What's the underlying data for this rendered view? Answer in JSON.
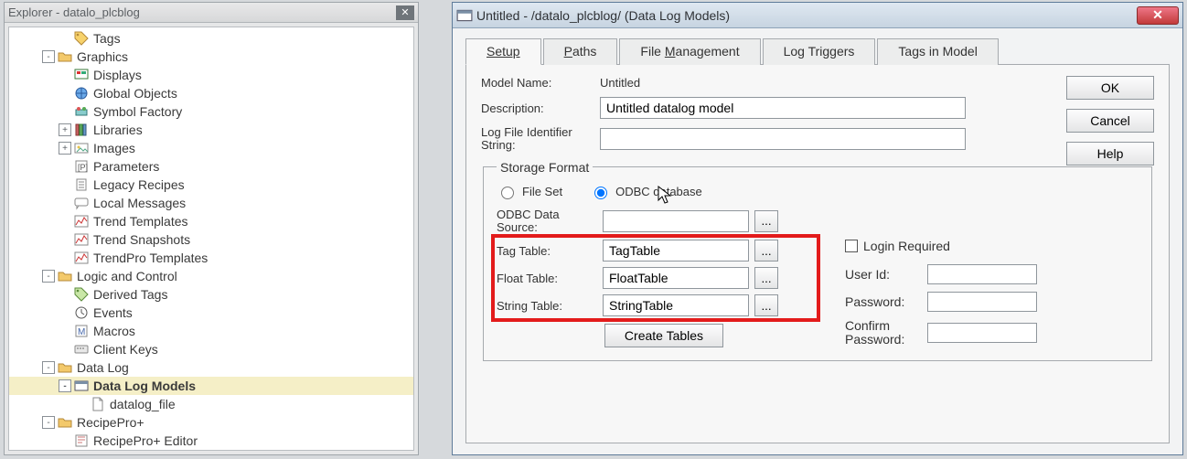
{
  "explorer": {
    "title": "Explorer - datalo_plcblog",
    "tree": [
      {
        "depth": 3,
        "twist": "",
        "icon": "tag",
        "label": "Tags"
      },
      {
        "depth": 2,
        "twist": "-",
        "icon": "folder",
        "label": "Graphics"
      },
      {
        "depth": 3,
        "twist": "",
        "icon": "displays",
        "label": "Displays"
      },
      {
        "depth": 3,
        "twist": "",
        "icon": "globals",
        "label": "Global Objects"
      },
      {
        "depth": 3,
        "twist": "",
        "icon": "symbol",
        "label": "Symbol Factory"
      },
      {
        "depth": 3,
        "twist": "+",
        "icon": "lib",
        "label": "Libraries"
      },
      {
        "depth": 3,
        "twist": "+",
        "icon": "images",
        "label": "Images"
      },
      {
        "depth": 3,
        "twist": "",
        "icon": "params",
        "label": "Parameters"
      },
      {
        "depth": 3,
        "twist": "",
        "icon": "recipe",
        "label": "Legacy Recipes"
      },
      {
        "depth": 3,
        "twist": "",
        "icon": "msg",
        "label": "Local Messages"
      },
      {
        "depth": 3,
        "twist": "",
        "icon": "trend",
        "label": "Trend Templates"
      },
      {
        "depth": 3,
        "twist": "",
        "icon": "trend",
        "label": "Trend Snapshots"
      },
      {
        "depth": 3,
        "twist": "",
        "icon": "trend",
        "label": "TrendPro Templates"
      },
      {
        "depth": 2,
        "twist": "-",
        "icon": "folder",
        "label": "Logic and Control"
      },
      {
        "depth": 3,
        "twist": "",
        "icon": "dtags",
        "label": "Derived Tags"
      },
      {
        "depth": 3,
        "twist": "",
        "icon": "events",
        "label": "Events"
      },
      {
        "depth": 3,
        "twist": "",
        "icon": "macros",
        "label": "Macros"
      },
      {
        "depth": 3,
        "twist": "",
        "icon": "keys",
        "label": "Client Keys"
      },
      {
        "depth": 2,
        "twist": "-",
        "icon": "folder",
        "label": "Data Log"
      },
      {
        "depth": 3,
        "twist": "-",
        "icon": "models",
        "label": "Data Log Models",
        "selected": true
      },
      {
        "depth": 4,
        "twist": "",
        "icon": "file",
        "label": "datalog_file"
      },
      {
        "depth": 2,
        "twist": "-",
        "icon": "folder",
        "label": "RecipePro+"
      },
      {
        "depth": 3,
        "twist": "",
        "icon": "recipepro",
        "label": "RecipePro+ Editor"
      }
    ]
  },
  "dialog": {
    "title": "Untitled - /datalo_plcblog/ (Data Log Models)",
    "tabs": {
      "setup": "Setup",
      "paths": "Paths",
      "file_mgmt": "File Management",
      "log_triggers": "Log Triggers",
      "tags_in_model": "Tags in Model"
    },
    "buttons": {
      "ok": "OK",
      "cancel": "Cancel",
      "help": "Help",
      "create_tables": "Create Tables",
      "browse": "..."
    },
    "labels": {
      "model_name": "Model Name:",
      "description": "Description:",
      "log_file_id": "Log File Identifier String:",
      "storage_format": "Storage Format",
      "file_set": "File Set",
      "odbc_database": "ODBC database",
      "odbc_data_source": "ODBC Data Source:",
      "tag_table": "Tag Table:",
      "float_table": "Float Table:",
      "string_table": "String Table:",
      "login_required": "Login Required",
      "user_id": "User Id:",
      "password": "Password:",
      "confirm_password": "Confirm Password:"
    },
    "values": {
      "model_name": "Untitled",
      "description": "Untitled datalog model",
      "log_file_id": "",
      "storage_format_selected": "odbc",
      "odbc_data_source": "",
      "tag_table": "TagTable",
      "float_table": "FloatTable",
      "string_table": "StringTable",
      "login_required": false,
      "user_id": "",
      "password": "",
      "confirm_password": ""
    }
  }
}
